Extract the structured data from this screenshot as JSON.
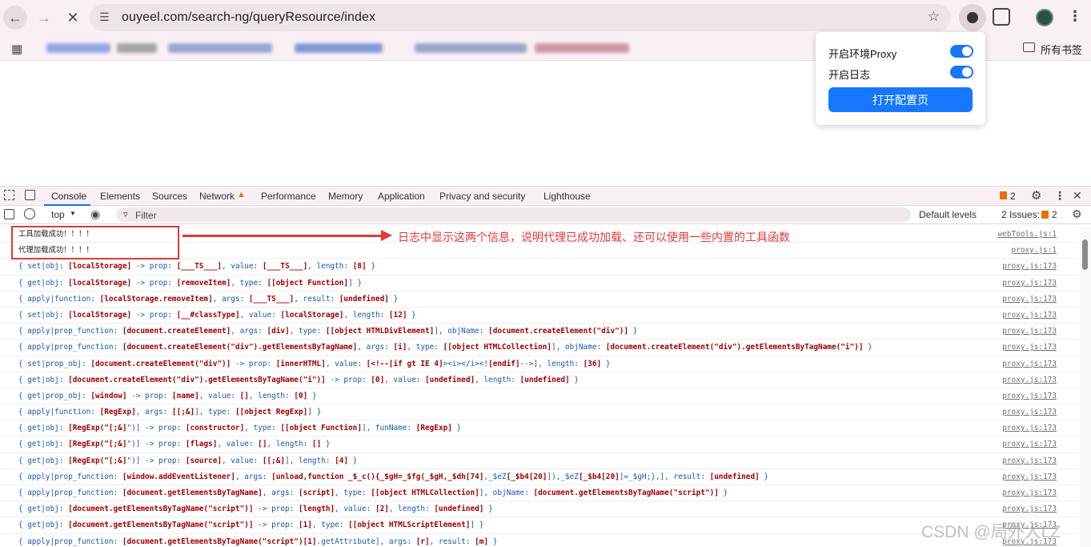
{
  "browser": {
    "url": "ouyeel.com/search-ng/queryResource/index",
    "bookmarks_label": "所有书签",
    "icons": [
      "back-icon",
      "forward-icon",
      "stop-icon",
      "site-info-icon",
      "star-icon",
      "extension-icon",
      "puzzle-icon",
      "profile-icon",
      "menu-icon",
      "apps-icon",
      "folder-icon"
    ]
  },
  "popup": {
    "toggle_proxy_label": "开启环境Proxy",
    "toggle_proxy_on": true,
    "toggle_log_label": "开启日志",
    "toggle_log_on": true,
    "open_config_button": "打开配置页"
  },
  "devtools": {
    "tabs": [
      "Console",
      "Elements",
      "Sources",
      "Network",
      "Performance",
      "Memory",
      "Application",
      "Privacy and security",
      "Lighthouse"
    ],
    "active_tab": "Console",
    "issue_count": "2",
    "context": "top",
    "filter_placeholder": "Filter",
    "levels": "Default levels",
    "issues_label": "2 Issues:",
    "issues_count2": "2"
  },
  "annotation": {
    "text": "日志中显示这两个信息，说明代理已成功加载、还可以使用一些内置的工具函数",
    "color": "#e53935"
  },
  "console": [
    {
      "text": "工具加载成功！！！！",
      "src": "webTools.js:1",
      "plain": true
    },
    {
      "text": "代理加载成功！！！！",
      "src": "proxy.js:1",
      "plain": true
    },
    {
      "text": "{ set|obj: [localStorage] -> prop: [___TS___], value: [___TS___], length: [8] }",
      "src": "proxy.js:173"
    },
    {
      "text": "{ get|obj: [localStorage] -> prop: [removeItem], type: [[object Function]] }",
      "src": "proxy.js:173"
    },
    {
      "text": "{ apply|function: [localStorage.removeItem], args: [___TS___], result: [undefined] }",
      "src": "proxy.js:173"
    },
    {
      "text": "{ set|obj: [localStorage] -> prop: [__#classType], value: [localStorage], length: [12] }",
      "src": "proxy.js:173"
    },
    {
      "text": "{ apply|prop_function: [document.createElement], args: [div], type: [[object HTMLDivElement]], objName: [document.createElement(\"div\")] }",
      "src": "proxy.js:173"
    },
    {
      "text": "{ apply|prop_function: [document.createElement(\"div\").getElementsByTagName], args: [i], type: [[object HTMLCollection]], objName: [document.createElement(\"div\").getElementsByTagName(\"i\")] }",
      "src": "proxy.js:173"
    },
    {
      "text": "{ set|prop_obj: [document.createElement(\"div\")] -> prop: [innerHTML], value: [<!--[if gt IE 4]><i></i><![endif]-->], length: [36] }",
      "src": "proxy.js:173"
    },
    {
      "text": "{ get|obj: [document.createElement(\"div\").getElementsByTagName(\"i\")] -> prop: [0], value: [undefined], length: [undefined] }",
      "src": "proxy.js:173"
    },
    {
      "text": "{ get|prop_obj: [window] -> prop: [name], value: [], length: [0] }",
      "src": "proxy.js:173"
    },
    {
      "text": "{ apply|function: [RegExp], args: [[;&]], type: [[object RegExp]] }",
      "src": "proxy.js:173"
    },
    {
      "text": "{ get|obj: [RegExp(\"[;&]\")] -> prop: [constructor], type: [[object Function]], funName: [RegExp] }",
      "src": "proxy.js:173"
    },
    {
      "text": "{ get|obj: [RegExp(\"[;&]\")] -> prop: [flags], value: [], length: [] }",
      "src": "proxy.js:173"
    },
    {
      "text": "{ get|obj: [RegExp(\"[;&]\")] -> prop: [source], value: [[;&]], length: [4] }",
      "src": "proxy.js:173"
    },
    {
      "text": "{ apply|prop_function: [window.addEventListener], args: [unload,function _$_c(){_$gH=_$fg(_$gH,_$dh[74],_$eZ[_$b4[20]]),_$eZ[_$b4[20]]=_$gH;},], result: [undefined] }",
      "src": "proxy.js:173"
    },
    {
      "text": "{ apply|prop_function: [document.getElementsByTagName], args: [script], type: [[object HTMLCollection]], objName: [document.getElementsByTagName(\"script\")] }",
      "src": "proxy.js:173"
    },
    {
      "text": "{ get|obj: [document.getElementsByTagName(\"script\")] -> prop: [length], value: [2], length: [undefined] }",
      "src": "proxy.js:173"
    },
    {
      "text": "{ get|obj: [document.getElementsByTagName(\"script\")] -> prop: [1], type: [[object HTMLScriptElement]] }",
      "src": "proxy.js:173"
    },
    {
      "text": "{ apply|prop_function: [document.getElementsByTagName(\"script\")[1].getAttribute], args: [r], result: [m] }",
      "src": "proxy.js:173"
    }
  ],
  "watermark": "CSDN @局外人LZ"
}
